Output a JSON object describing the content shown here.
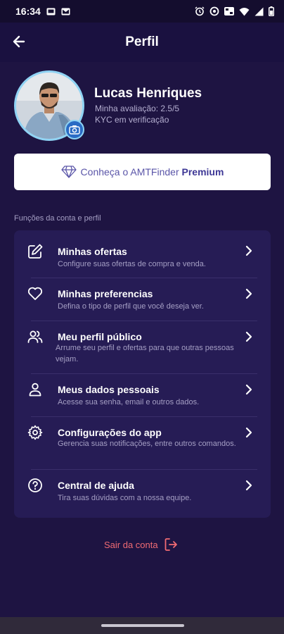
{
  "status_bar": {
    "time": "16:34"
  },
  "header": {
    "title": "Perfil"
  },
  "profile": {
    "name": "Lucas Henriques",
    "rating": "Minha avaliação: 2.5/5",
    "kyc": "KYC em verificação"
  },
  "premium": {
    "prefix": "Conheça o AMTFinder",
    "highlight": "Premium"
  },
  "section_label": "Funções da conta e perfil",
  "menu": [
    {
      "title": "Minhas ofertas",
      "desc": "Configure suas ofertas de compra e venda.",
      "icon": "edit-icon"
    },
    {
      "title": "Minhas preferencias",
      "desc": "Defina o tipo de perfil que você deseja ver.",
      "icon": "heart-icon"
    },
    {
      "title": "Meu perfil público",
      "desc": "Arrume seu perfil e ofertas para que outras pessoas vejam.",
      "icon": "users-icon"
    },
    {
      "title": "Meus dados pessoais",
      "desc": "Acesse sua senha, email e outros dados.",
      "icon": "person-icon"
    },
    {
      "title": "Configurações do app",
      "desc": "Gerencia suas notificações, entre outros comandos.",
      "icon": "gear-icon"
    },
    {
      "title": "Central de ajuda",
      "desc": "Tira suas dúvidas com a nossa equipe.",
      "icon": "help-icon"
    }
  ],
  "logout": {
    "label": "Sair da conta"
  },
  "colors": {
    "background": "#1e1442",
    "card": "#261c55",
    "accent_red": "#f06b73",
    "avatar_ring": "#8fd3f4",
    "premium_text": "#3e3896"
  }
}
